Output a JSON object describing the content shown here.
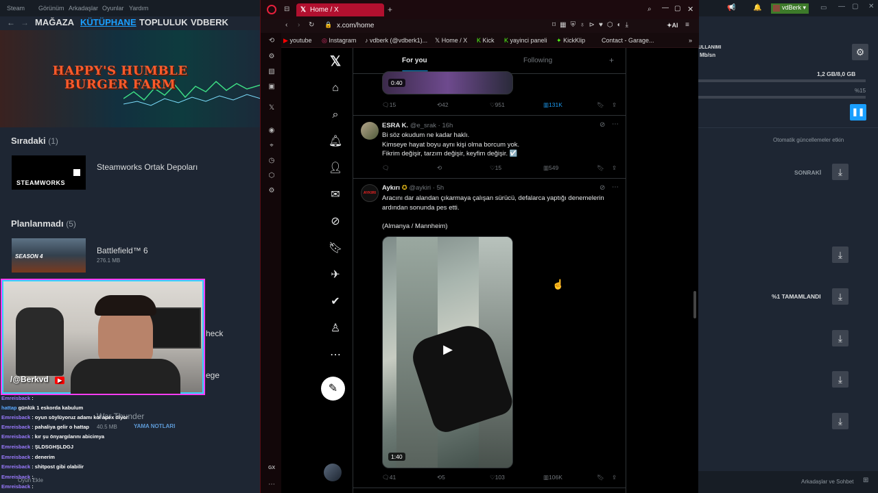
{
  "steam": {
    "menu": [
      "Steam",
      "Görünüm",
      "Arkadaşlar",
      "Oyunlar",
      "Yardım"
    ],
    "nav": [
      "MAĞAZA",
      "KÜTÜPHANE",
      "TOPLULUK",
      "VDBERK"
    ],
    "banner_title_1": "HAPPY'S HUMBLE",
    "banner_title_2": "BURGER FARM",
    "queue_label": "Sıradaki",
    "queue_count": "(1)",
    "queue_game": "Steamworks Ortak Depoları",
    "steamworks_logo": "STEAMWORKS",
    "unplanned_label": "Planlanmadı",
    "unplanned_count": "(5)",
    "unplanned_game": "Battlefield™ 6",
    "unplanned_size": "276.1 MB",
    "bf_badge": "SEASON 4",
    "partial_1": "heck",
    "partial_2": "ege",
    "wethunder": "War Thunder",
    "wethunder_size": "40.5 MB",
    "patch_notes": "YAMA NOTLARI",
    "add_game": "Oyun Ekle",
    "user": "vdBerk",
    "usage_label": "ULLANIMI",
    "usage_speed": "Mb/sn",
    "disk": "1,2 GB/8,0 GB",
    "percent": "%15",
    "auto_updates": "Otomatik güncellemeler etkin",
    "next": "SONRAKİ",
    "completed": "%1 TAMAMLANDI",
    "friends_chat": "Arkadaşlar ve Sohbet"
  },
  "webcam": {
    "handle": "/@Berkvd"
  },
  "chat": [
    {
      "user": "Emreisback",
      "msg": ":"
    },
    {
      "user": "hattap",
      "msg": "günlük 1 eskorda kabulum"
    },
    {
      "user": "Emreisback",
      "msg": ": oyun söylüyoruz adamı kol apex diyor"
    },
    {
      "user": "Emreisback",
      "msg": ": pahaliya gelir o hattap"
    },
    {
      "user": "Emreisback",
      "msg": ": kır şu önyargılarını abicimya"
    },
    {
      "user": "Emreisback",
      "msg": ": ŞLDSGHŞLDGJ"
    },
    {
      "user": "Emreisback",
      "msg": ": denerim"
    },
    {
      "user": "Emreisback",
      "msg": ": shitpost gibi olabilir"
    },
    {
      "user": "Emreisback",
      "msg": ":"
    },
    {
      "user": "Emreisback",
      "msg": ":"
    }
  ],
  "browser": {
    "tab_title": "Home / X",
    "url": "x.com/home",
    "ai_label": "AI",
    "bookmarks": [
      "youtube",
      "Instagram",
      "vdberk (@vdberk1)...",
      "Home / X",
      "Kick",
      "yayinci paneli",
      "KickKlip",
      "Contact - Garage..."
    ],
    "gx_label": "GX"
  },
  "x": {
    "tabs": {
      "for_you": "For you",
      "following": "Following"
    },
    "tweet0": {
      "duration": "0:40",
      "replies": "15",
      "retweets": "42",
      "likes": "951",
      "views": "131K"
    },
    "tweet1": {
      "name": "ESRA K.",
      "handle": "@e_srak",
      "time": "16h",
      "text": "Bi söz okudum ne kadar haklı.\nKimseye hayat boyu aynı kişi olma borcum yok.\nFikrim değişir, tarzım değişir, keyfim değişir. ☑️",
      "replies": "",
      "retweets": "",
      "likes": "15",
      "views": "549"
    },
    "tweet2": {
      "name": "Aykırı",
      "handle": "@aykiri",
      "time": "5h",
      "avatar_text": "AYKIRI",
      "text": "Aracını dar alandan çıkarmaya çalışan sürücü, defalarca yaptığı denemelerin ardından sonunda pes etti.\n\n(Almanya / Mannheim)",
      "duration": "1:40",
      "replies": "41",
      "retweets": "5",
      "likes": "103",
      "views": "106K"
    }
  },
  "colors": {
    "x_blue": "#1d9bf0",
    "opera_red": "#b2102f",
    "steam_bg": "#1e2633"
  }
}
